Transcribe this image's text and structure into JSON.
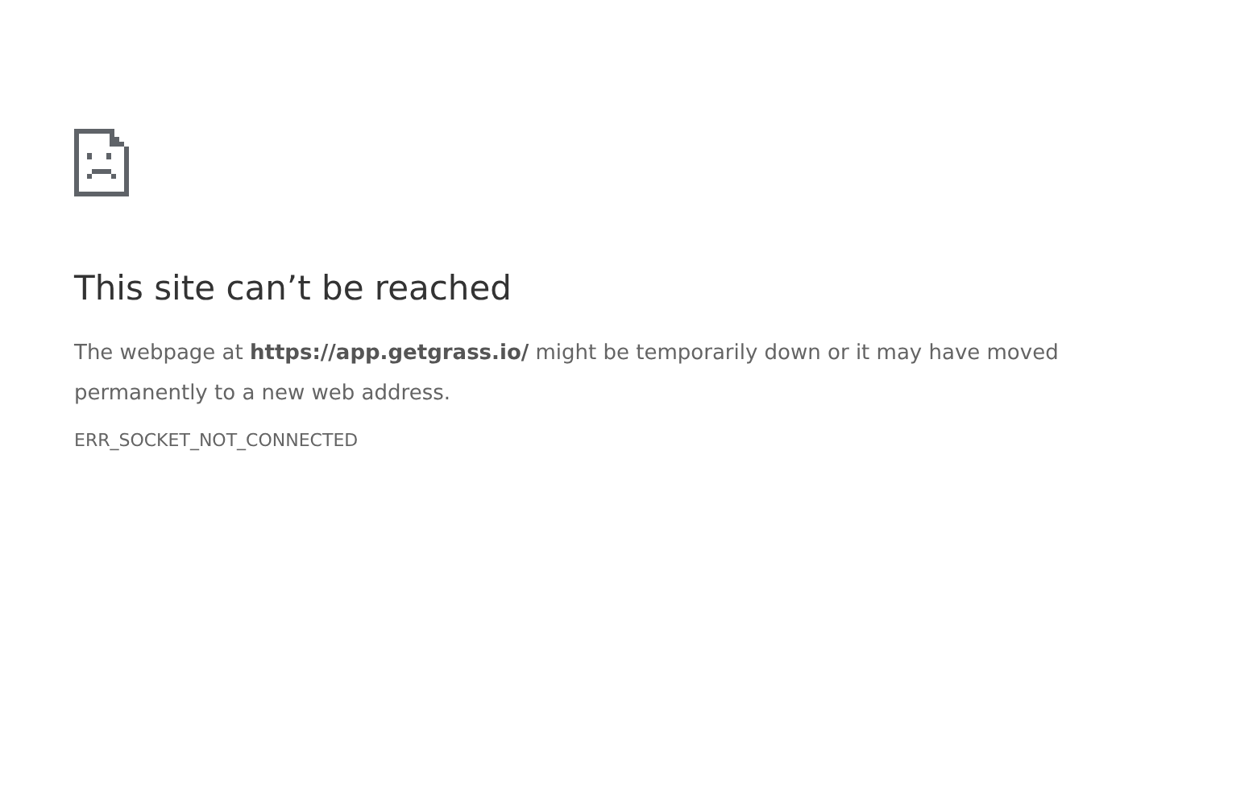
{
  "heading": "This site can’t be reached",
  "message": "The webpage at **https://app.getgrass.io/** might be temporarily down or it may have moved permanently to a new web address.",
  "error_code": "ERR_SOCKET_NOT_CONNECTED"
}
